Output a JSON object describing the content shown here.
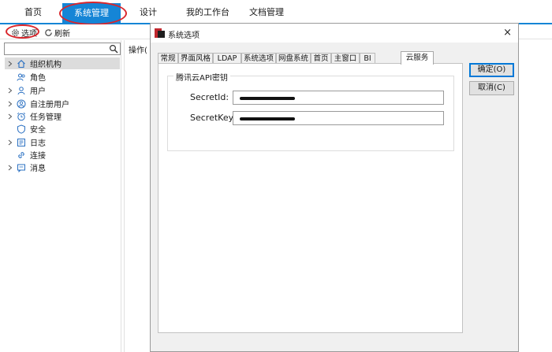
{
  "menu": {
    "items": [
      "首页",
      "系统管理",
      "设计",
      "我的工作台",
      "文档管理"
    ],
    "active_index": 1
  },
  "toolbar": {
    "options_label": "选项",
    "refresh_label": "刷新"
  },
  "tree": {
    "search": {
      "value": "",
      "placeholder": ""
    },
    "items": [
      {
        "label": "组织机构",
        "icon": "org-home-icon",
        "expandable": true,
        "selected": true
      },
      {
        "label": "角色",
        "icon": "role-users-icon",
        "expandable": false,
        "selected": false
      },
      {
        "label": "用户",
        "icon": "user-icon",
        "expandable": true,
        "selected": false
      },
      {
        "label": "自注册用户",
        "icon": "user-circle-icon",
        "expandable": true,
        "selected": false
      },
      {
        "label": "任务管理",
        "icon": "alarm-clock-icon",
        "expandable": true,
        "selected": false
      },
      {
        "label": "安全",
        "icon": "shield-icon",
        "expandable": false,
        "selected": false
      },
      {
        "label": "日志",
        "icon": "log-icon",
        "expandable": true,
        "selected": false
      },
      {
        "label": "连接",
        "icon": "link-icon",
        "expandable": false,
        "selected": false
      },
      {
        "label": "消息",
        "icon": "message-icon",
        "expandable": true,
        "selected": false
      }
    ]
  },
  "operation_header": "操作(",
  "dialog": {
    "title": "系统选项",
    "close_glyph": "×",
    "tabs": [
      "常规",
      "界面风格",
      "LDAP",
      "系统选项",
      "网盘系统",
      "首页",
      "主窗口",
      "BI",
      "云服务"
    ],
    "active_tab_index": 8,
    "group_title": "腾讯云API密钥",
    "fields": [
      {
        "label": "SecretId:",
        "value_redacted": true
      },
      {
        "label": "SecretKey:",
        "value_redacted": true
      }
    ],
    "ok_label": "确定(O)",
    "cancel_label": "取消(C)"
  },
  "colors": {
    "accent": "#1585d6",
    "annotation_red": "#d9262c",
    "dialog_bg": "#f0f0f0",
    "selected_row": "#dcdcdc",
    "button_focus": "#0078d7"
  }
}
